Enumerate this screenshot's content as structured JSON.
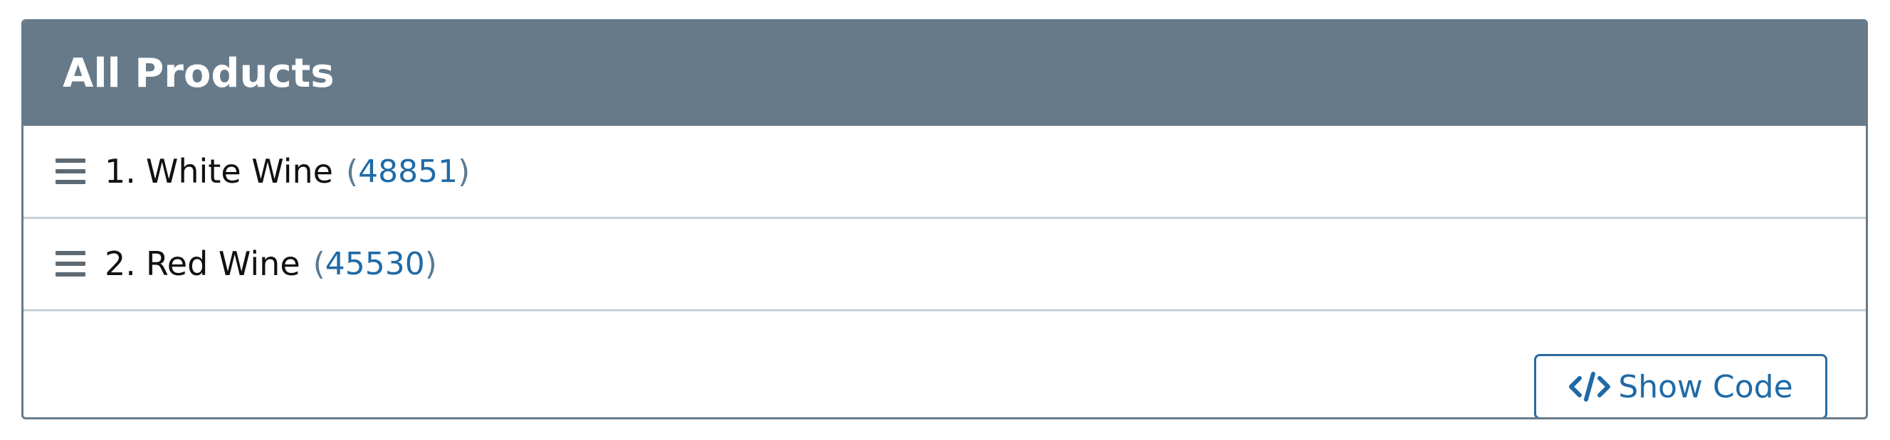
{
  "panel": {
    "title": "All Products"
  },
  "items": [
    {
      "index": "1.",
      "name": "White Wine",
      "count_open": "(",
      "count": "48851",
      "count_close": ")"
    },
    {
      "index": "2.",
      "name": "Red Wine",
      "count_open": "(",
      "count": "45530",
      "count_close": ")"
    }
  ],
  "footer": {
    "show_code_label": "Show Code",
    "show_code_icon": "code-icon"
  },
  "colors": {
    "header_bg": "#677a8a",
    "link": "#1f6aa6",
    "border": "#677a8a"
  }
}
